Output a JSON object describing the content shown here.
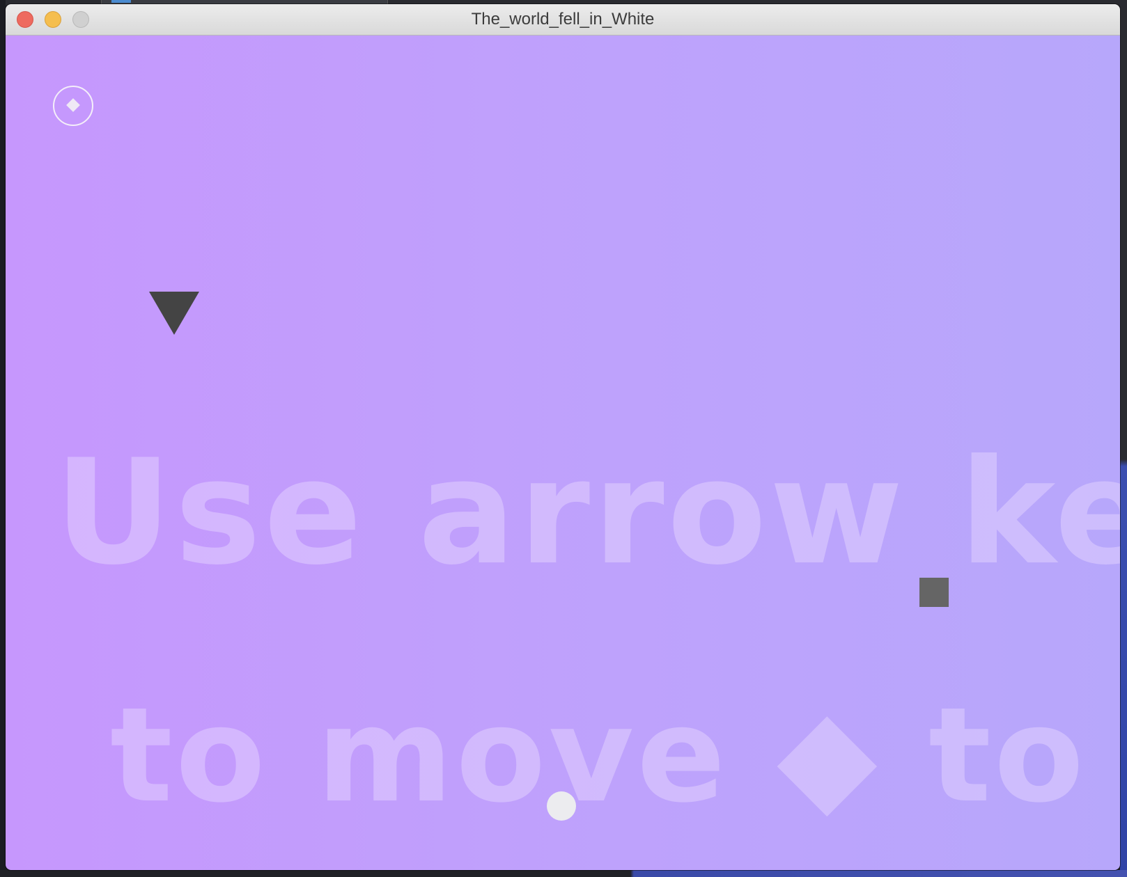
{
  "window": {
    "title": "The_world_fell_in_White"
  },
  "game": {
    "instruction_line_1": "Use arrow keys",
    "instruction_line_2": "to move ◆ to ●",
    "icons": {
      "goal": "diamond-in-ring-icon",
      "enemy_1": "triangle-down-icon",
      "enemy_2": "square-icon",
      "player": "circle-icon"
    },
    "colors": {
      "background_left": "#c697fd",
      "background_right": "#b7a7fb",
      "hint_text": "#e8daff",
      "enemy": "#444444",
      "enemy_square": "#656565",
      "player": "#ececef"
    }
  }
}
